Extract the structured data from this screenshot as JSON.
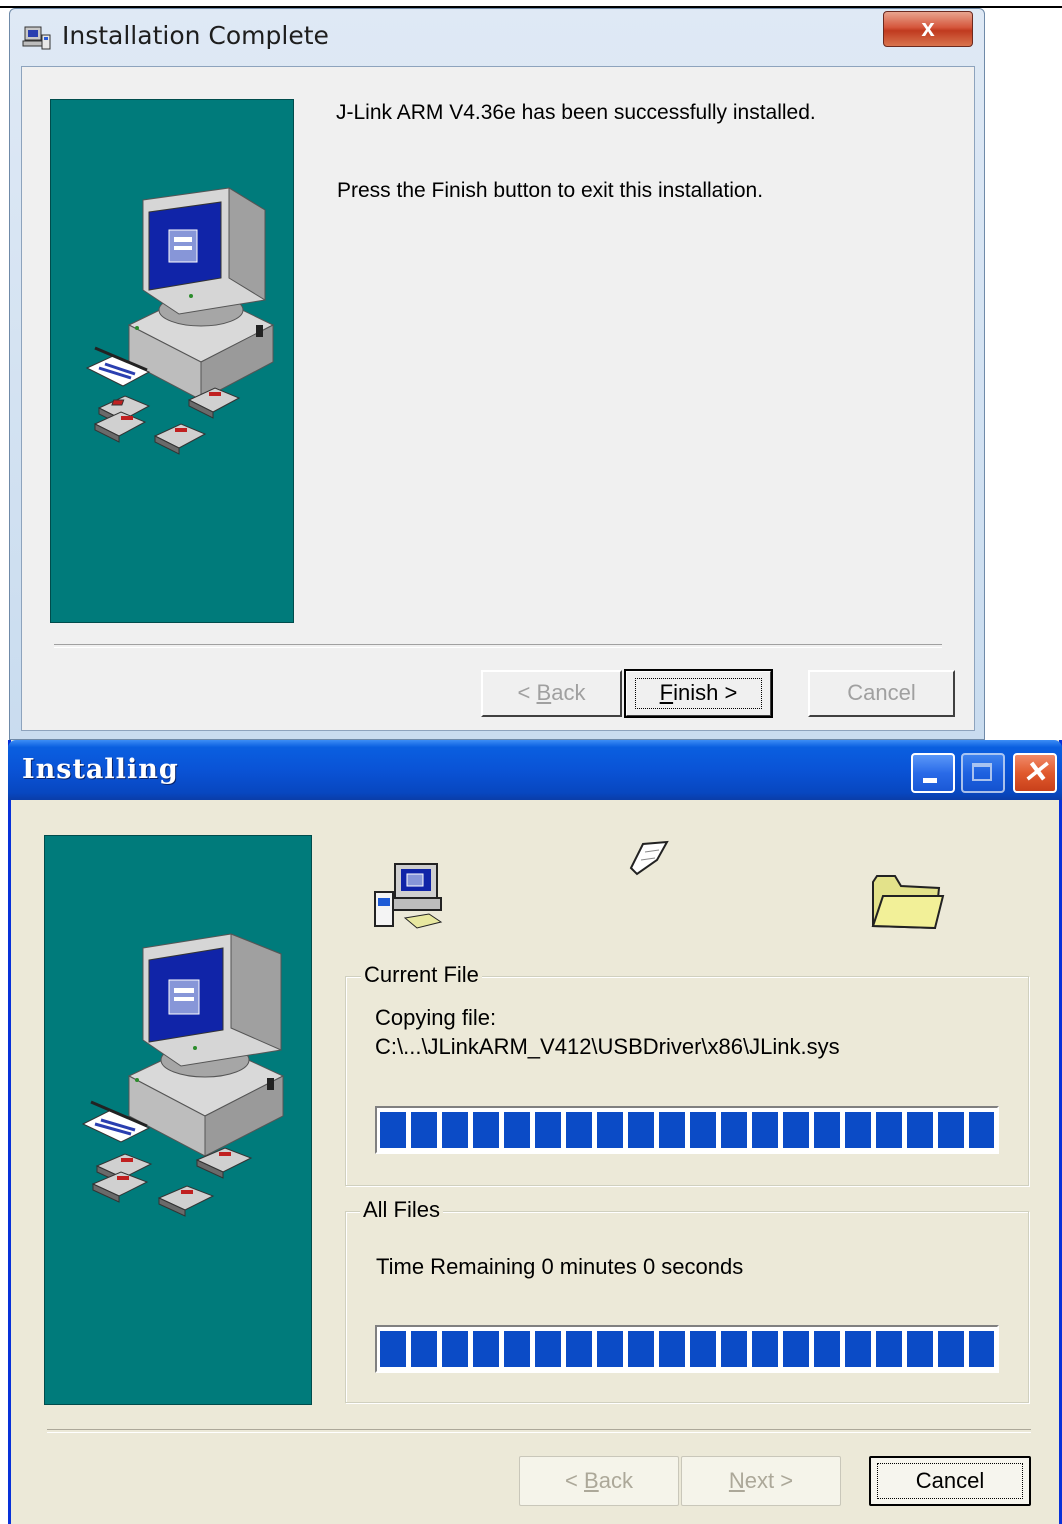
{
  "complete_dialog": {
    "title": "Installation Complete",
    "message_installed": "J-Link ARM V4.36e has been successfully installed.",
    "message_finish": "Press the Finish button to exit this installation.",
    "buttons": {
      "back": {
        "mnemonic": "B",
        "rest": "ack",
        "prefix": "< ",
        "enabled": false
      },
      "finish": {
        "mnemonic": "F",
        "rest": "inish >",
        "enabled": true,
        "default": true
      },
      "cancel": {
        "label": "Cancel",
        "enabled": false
      }
    },
    "close_glyph": "x",
    "icons": [
      "installer-app-icon",
      "close-icon",
      "computer-illustration",
      "floppy-disks-illustration"
    ]
  },
  "installing_dialog": {
    "title": "Installing",
    "current_file": {
      "group_label": "Current File",
      "action": "Copying file:",
      "path": "C:\\...\\JLinkARM_V412\\USBDriver\\x86\\JLink.sys",
      "progress": 1.0
    },
    "all_files": {
      "group_label": "All Files",
      "time_remaining": "Time Remaining 0 minutes 0 seconds",
      "progress": 1.0
    },
    "buttons": {
      "back": {
        "prefix": "< ",
        "mnemonic": "B",
        "rest": "ack",
        "enabled": false
      },
      "next": {
        "mnemonic": "N",
        "rest": "ext >",
        "enabled": false
      },
      "cancel": {
        "label": "Cancel",
        "enabled": true
      }
    },
    "titlebar_glyphs": {
      "close": "✕"
    },
    "icons": [
      "setup-computer-icon",
      "flying-document-icon",
      "folder-icon",
      "minimize-icon",
      "maximize-icon",
      "close-icon"
    ]
  },
  "colors": {
    "teal_panel": "#007b7b",
    "xp_titlebar": "#0a53d6",
    "progress_block": "#0b4bc6",
    "xp_face": "#ece9d8",
    "win7_face": "#f0f0f0"
  }
}
